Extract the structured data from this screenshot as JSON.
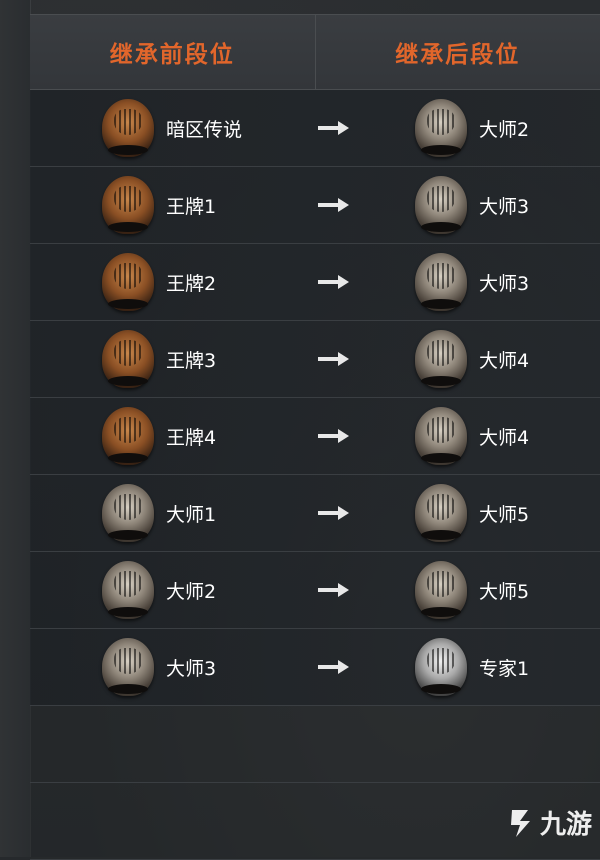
{
  "table": {
    "header_before": "继承前段位",
    "header_after": "继承后段位",
    "rows": [
      {
        "before": "暗区传说",
        "before_icon": "legend-tiger-badge-icon",
        "after": "大师2",
        "after_icon": "master-tiger-badge-icon"
      },
      {
        "before": "王牌1",
        "before_icon": "ace-tiger-badge-icon",
        "after": "大师3",
        "after_icon": "master-tiger-badge-icon"
      },
      {
        "before": "王牌2",
        "before_icon": "ace-tiger-badge-icon",
        "after": "大师3",
        "after_icon": "master-tiger-badge-icon"
      },
      {
        "before": "王牌3",
        "before_icon": "ace-tiger-badge-icon",
        "after": "大师4",
        "after_icon": "master-tiger-badge-icon"
      },
      {
        "before": "王牌4",
        "before_icon": "ace-tiger-badge-icon",
        "after": "大师4",
        "after_icon": "master-tiger-badge-icon"
      },
      {
        "before": "大师1",
        "before_icon": "master-tiger-badge-icon",
        "after": "大师5",
        "after_icon": "master-tiger-badge-icon"
      },
      {
        "before": "大师2",
        "before_icon": "master-tiger-badge-icon",
        "after": "大师5",
        "after_icon": "master-tiger-badge-icon"
      },
      {
        "before": "大师3",
        "before_icon": "master-tiger-badge-icon",
        "after": "专家1",
        "after_icon": "expert-wolf-badge-icon"
      }
    ]
  },
  "watermark": {
    "text": "九游",
    "icon": "jiuyou-logo-icon"
  },
  "colors": {
    "header_text": "#e2662b",
    "row_text": "#ffffff",
    "background": "#26292c"
  }
}
